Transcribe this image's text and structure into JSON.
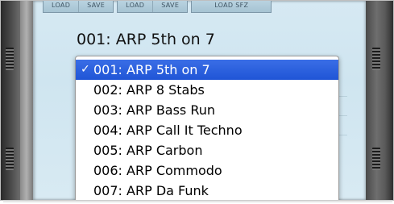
{
  "toolbar": {
    "groups": [
      {
        "buttons": [
          "LOAD",
          "SAVE"
        ]
      },
      {
        "buttons": [
          "LOAD",
          "SAVE"
        ]
      },
      {
        "buttons": [
          "LOAD SFZ"
        ]
      }
    ]
  },
  "preset": {
    "current_label": "001: ARP 5th on 7"
  },
  "menu": {
    "selected_index": 0,
    "checkmark": "✓",
    "items": [
      "001: ARP 5th on 7",
      "002: ARP 8 Stabs",
      "003: ARP Bass Run",
      "004: ARP Call It Techno",
      "005: ARP Carbon",
      "006: ARP Commodo",
      "007: ARP Da Funk"
    ]
  },
  "colors": {
    "selection": "#2a62de",
    "panel": "#d3e8f2",
    "rail": "#3e3e3e"
  }
}
